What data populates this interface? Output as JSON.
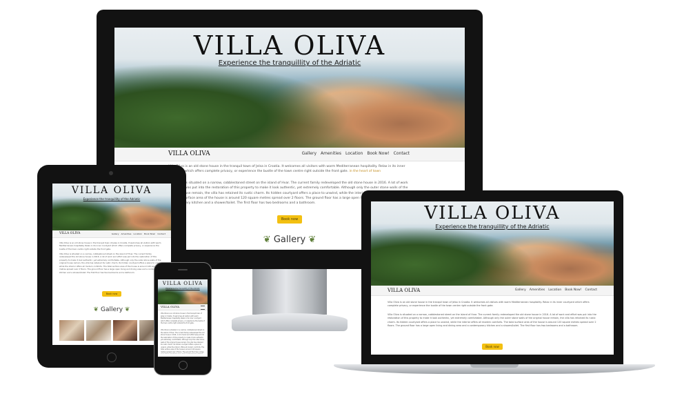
{
  "site": {
    "title": "VILLA OLIVA",
    "subtitle": "Experience the tranquillity of the Adriatic",
    "brand": "VILLA OLIVA",
    "nav": [
      "Gallery",
      "Amenities",
      "Location",
      "Book Now!",
      "Contact"
    ],
    "intro": "Villa Oliva is an old stone house in the tranquil town of Jelsa in Croatia. It welcomes all visitors with warm Mediterranean hospitality. Relax in its inner courtyard which offers complete privacy, or experience the bustle of the town centre right outside the front gate.",
    "intro_link": "in the heart of town",
    "history": "Villa Oliva is situated on a narrow, cobblestoned street on the island of Hvar. The current family redeveloped the old stone house in 2016. A lot of work and effort was put into the restoration of this property to make it look authentic, yet extremely comfortable. Although only the outer stone walls of the original house remain, the villa has retained its rustic charm. Its hidden courtyard offers a place to unwind, while the interior offers all modern comforts. The total surface area of the house is around 120 square metres spread over 2 floors. The ground floor has a large open living and dining area and a contemporary kitchen and a shower/toilet. The first floor has two bedrooms and a bathroom.",
    "cta": "Book now",
    "gallery_heading": "Gallery",
    "leaf_left": "❦",
    "leaf_right": "❦"
  },
  "colors": {
    "accent": "#f3c012",
    "device_frame": "#121212",
    "laptop_body": "#c9cbcf"
  },
  "icons": {
    "hamburger": "menu-icon",
    "home_button": "home-button-icon",
    "camera": "camera-icon"
  }
}
